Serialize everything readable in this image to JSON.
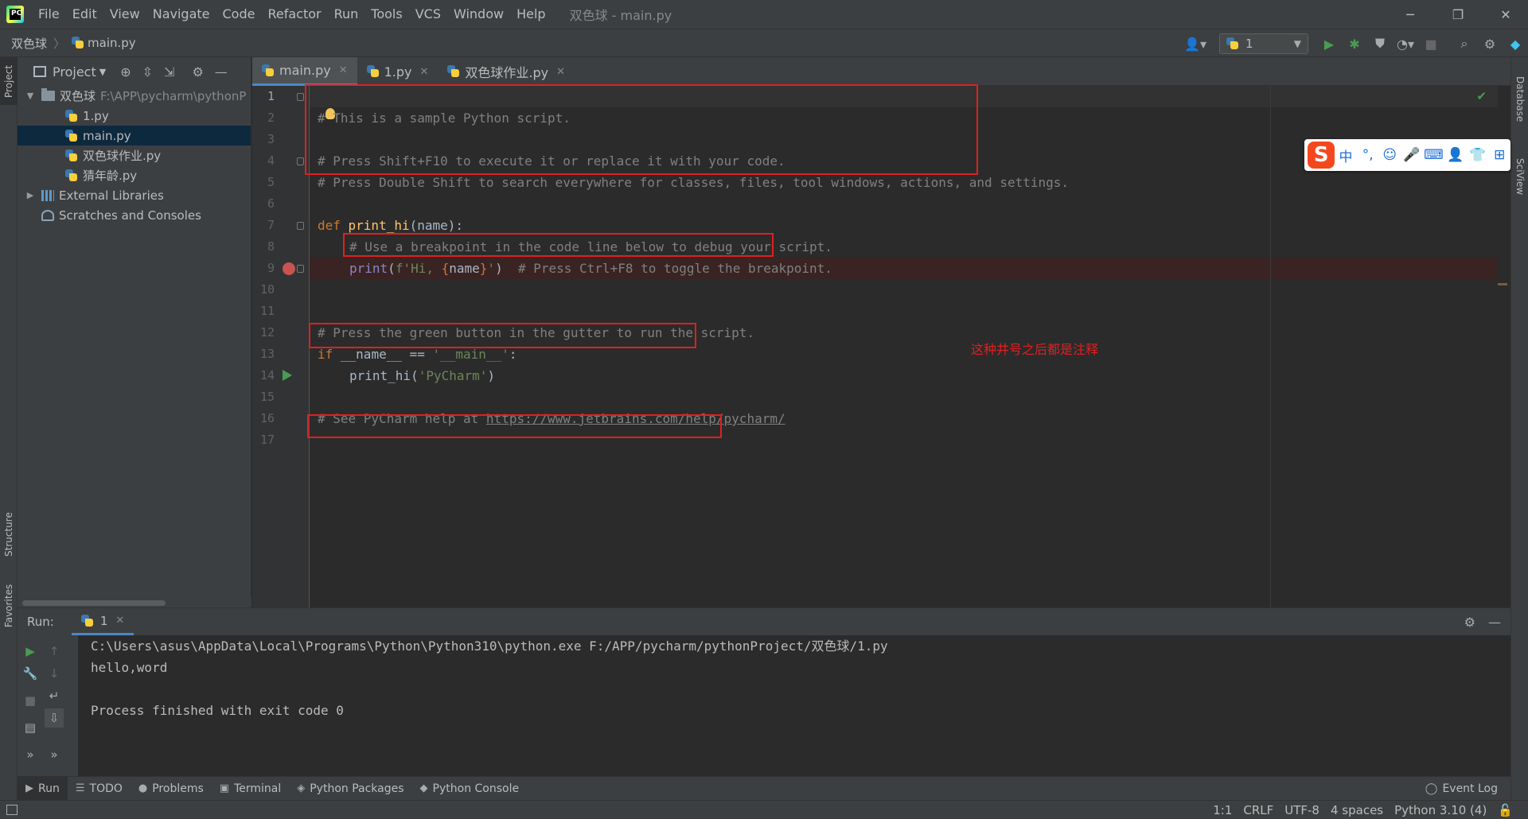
{
  "titlebar": {
    "menu": [
      "File",
      "Edit",
      "View",
      "Navigate",
      "Code",
      "Refactor",
      "Run",
      "Tools",
      "VCS",
      "Window",
      "Help"
    ],
    "window_title": "双色球 - main.py",
    "minimize": "─",
    "restore": "❐",
    "close": "✕"
  },
  "navbar": {
    "project": "双色球",
    "file": "main.py",
    "run_config": "1",
    "icons": [
      "user-icon",
      "run-icon",
      "debug-icon",
      "coverage-icon",
      "profile-icon",
      "stop-icon",
      "search-icon",
      "gear-icon",
      "jetbrains-icon"
    ]
  },
  "left_stripe": {
    "project": "Project",
    "structure": "Structure",
    "favorites": "Favorites"
  },
  "right_stripe": {
    "database": "Database",
    "sciview": "SciView"
  },
  "project_panel": {
    "title": "Project",
    "root_name": "双色球",
    "root_path": "F:\\APP\\pycharm\\pythonP",
    "files": [
      "1.py",
      "main.py",
      "双色球作业.py",
      "猜年龄.py"
    ],
    "selected": "main.py",
    "external_libraries": "External Libraries",
    "scratches": "Scratches and Consoles"
  },
  "editor_tabs": [
    {
      "label": "main.py",
      "active": true
    },
    {
      "label": "1.py",
      "active": false
    },
    {
      "label": "双色球作业.py",
      "active": false
    }
  ],
  "editor": {
    "line_numbers": [
      "1",
      "2",
      "3",
      "4",
      "5",
      "6",
      "7",
      "8",
      "9",
      "10",
      "11",
      "12",
      "13",
      "14",
      "15",
      "16",
      "17"
    ],
    "line1": "# This is a sample Python script.",
    "line3": "# Press Shift+F10 to execute it or replace it with your code.",
    "line4": "# Press Double Shift to search everywhere for classes, files, tool windows, actions, and settings.",
    "line7_kw": "def ",
    "line7_fn": "print_hi",
    "line7_rest": "(name):",
    "line8": "# Use a breakpoint in the code line below to debug your script.",
    "line9_builtin": "print",
    "line9_open": "(",
    "line9_str1": "f'Hi, ",
    "line9_lbrace": "{",
    "line9_name": "name",
    "line9_rbrace": "}",
    "line9_str2": "'",
    "line9_close": ")",
    "line9_comment": "  # Press Ctrl+F8 to toggle the breakpoint.",
    "line12": "# Press the green button in the gutter to run the script.",
    "line13_kw": "if ",
    "line13_mid": "__name__ == ",
    "line13_str": "'__main__'",
    "line13_end": ":",
    "line14_fn": "print_hi(",
    "line14_str": "'PyCharm'",
    "line14_end": ")",
    "line16_pre": "# See PyCharm help at ",
    "line16_url": "https://www.jetbrains.com/help/pycharm/",
    "annotation": "这种井号之后都是注释"
  },
  "ime_bar": {
    "logo": "S",
    "items": [
      "中",
      "°,",
      "☺",
      "🎤",
      "⌨",
      "👤",
      "👕",
      "⊞"
    ]
  },
  "run_panel": {
    "title": "Run:",
    "tab": "1",
    "console": [
      "C:\\Users\\asus\\AppData\\Local\\Programs\\Python\\Python310\\python.exe F:/APP/pycharm/pythonProject/双色球/1.py",
      "hello,word",
      "",
      "Process finished with exit code 0"
    ]
  },
  "bottom_tools": [
    {
      "label": "Run",
      "icon": "▶",
      "active": true
    },
    {
      "label": "TODO",
      "icon": "☰",
      "active": false
    },
    {
      "label": "Problems",
      "icon": "●",
      "active": false
    },
    {
      "label": "Terminal",
      "icon": "▣",
      "active": false
    },
    {
      "label": "Python Packages",
      "icon": "◈",
      "active": false
    },
    {
      "label": "Python Console",
      "icon": "◆",
      "active": false
    }
  ],
  "event_log": "Event Log",
  "status_bar": {
    "position": "1:1",
    "line_sep": "CRLF",
    "encoding": "UTF-8",
    "indent": "4 spaces",
    "interpreter": "Python 3.10 (4)"
  },
  "colors": {
    "annotation": "#e02020",
    "comment": "#808080",
    "keyword": "#cc7832",
    "function": "#ffc66d",
    "string": "#6a8759",
    "accent": "#4a88c7"
  }
}
